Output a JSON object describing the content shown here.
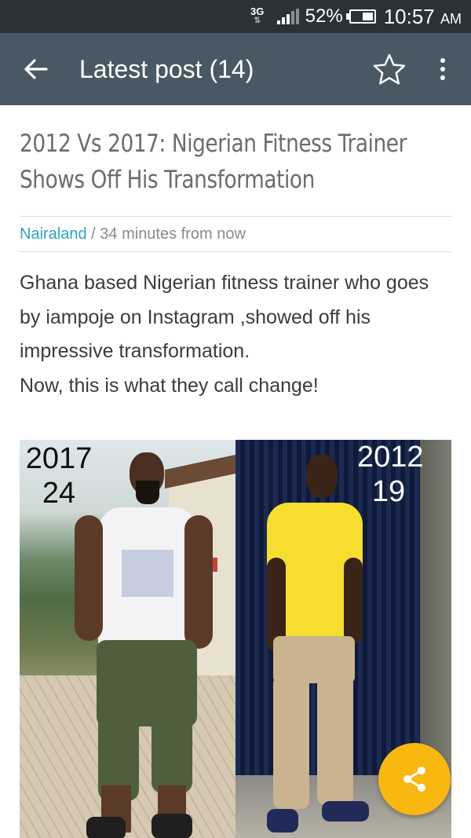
{
  "status_bar": {
    "network": "3G",
    "battery_percent": "52%",
    "time": "10:57",
    "time_suffix": "AM"
  },
  "app_bar": {
    "title": "Latest post (14)",
    "back_icon": "arrow-left-icon",
    "star_icon": "star-outline-icon",
    "more_icon": "more-vert-icon"
  },
  "article": {
    "title": "2012 Vs 2017: Nigerian Fitness Trainer Shows Off His Transformation",
    "source": "Nairaland",
    "separator": " / ",
    "time": "34 minutes from now",
    "paragraph_1": "Ghana based Nigerian fitness trainer who goes by iampoje on Instagram ,showed off his impressive transformation.",
    "paragraph_2": "Now, this is what they call change!"
  },
  "photo": {
    "left_year": "2017",
    "left_age": "24",
    "right_year": "2012",
    "right_age": "19"
  },
  "fab": {
    "icon": "share-icon"
  },
  "colors": {
    "status_bar": "#283237",
    "app_bar": "#485963",
    "source_link": "#2aa5c4",
    "fab": "#f9b80f"
  }
}
